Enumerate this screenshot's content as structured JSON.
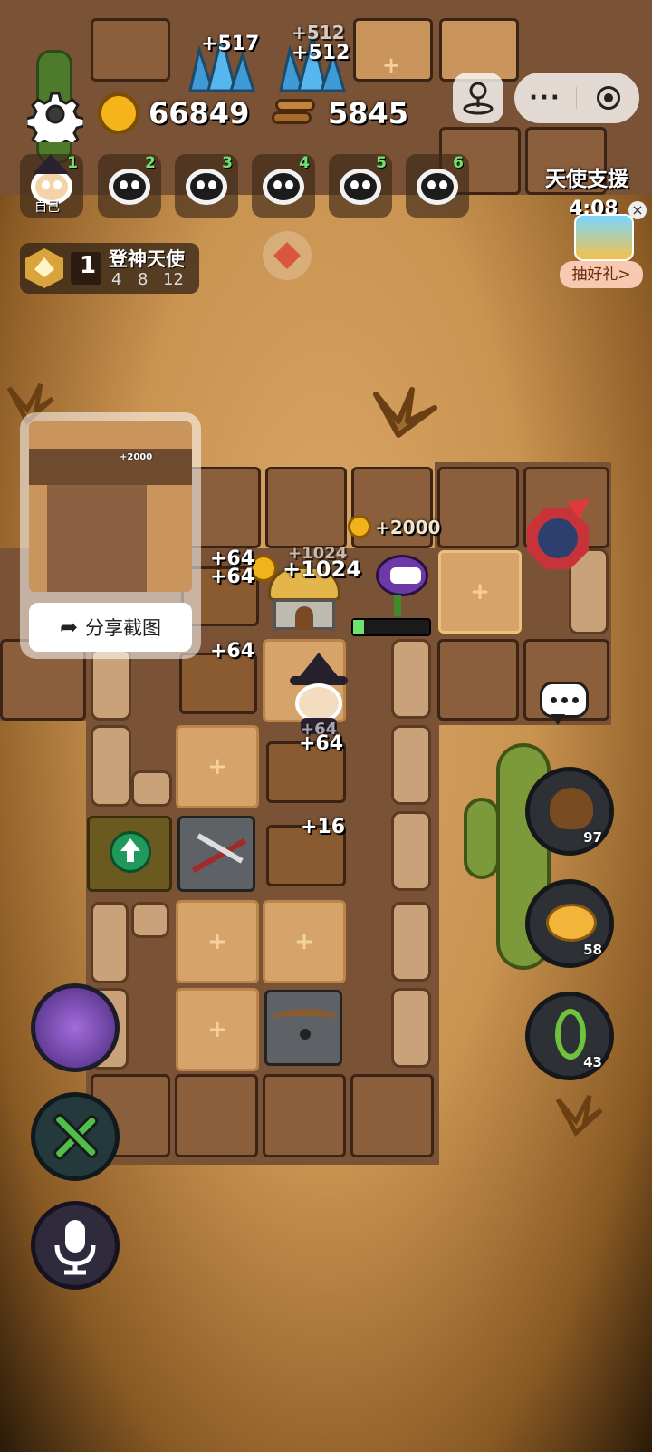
{
  "hud": {
    "coins": "66849",
    "wood": "5845",
    "gem_gain_left": "+517",
    "gem_gain_right": "+512",
    "gem_gain_right_back": "+512"
  },
  "players": [
    {
      "num": "1",
      "label": "自己"
    },
    {
      "num": "2"
    },
    {
      "num": "3"
    },
    {
      "num": "4"
    },
    {
      "num": "5"
    },
    {
      "num": "6"
    }
  ],
  "rank": {
    "level": "1",
    "title": "登神天使",
    "stages": [
      "4",
      "8",
      "12"
    ]
  },
  "support": {
    "title": "天使支援",
    "timer": "4:08",
    "button": "抽好礼>",
    "close": "×"
  },
  "share": {
    "label": "分享截图",
    "mini_gain": "+2000"
  },
  "board": {
    "gain_2000": "+2000",
    "gain_64_a": "+64",
    "gain_64_b": "+64",
    "gain_1024": "+1024",
    "gain_1024_back": "+1024",
    "gain_64_c": "+64",
    "gain_64_d": "+64",
    "gain_64_back": "+64",
    "gain_16": "+16",
    "plus": "+"
  },
  "side_buttons": {
    "poop_count": "97",
    "piggy_count": "58",
    "vine_count": "43"
  },
  "icons": {
    "settings": "gear-icon",
    "joystick": "joystick-icon",
    "more": "more-icon",
    "record": "record-icon",
    "chat": "chat-icon",
    "tools": "tools-icon",
    "mic": "microphone-icon",
    "share": "share-arrow-icon"
  },
  "colors": {
    "hud_pill": "#3b2a1a",
    "health_green": "#6ee36e",
    "accent_orange": "#f6c9b0"
  }
}
